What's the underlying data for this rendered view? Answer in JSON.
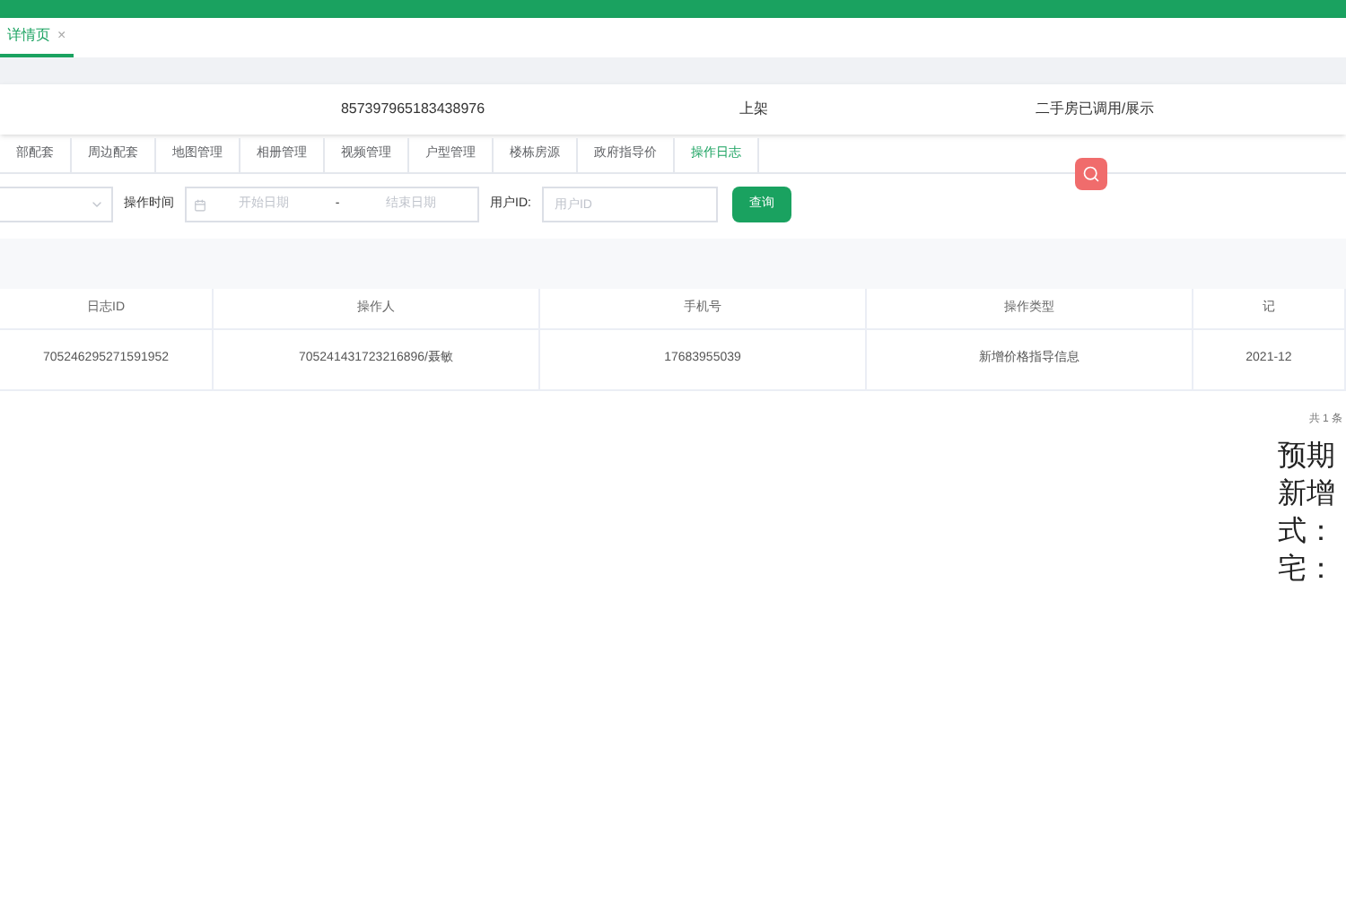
{
  "page_tabs": [
    {
      "label": "详情页",
      "close": "×",
      "selected": true
    }
  ],
  "summary": [
    "857397965183438976",
    "上架",
    "二手房已调用/展示"
  ],
  "tabs": [
    {
      "label": "部配套",
      "selected": false
    },
    {
      "label": "周边配套",
      "selected": false
    },
    {
      "label": "地图管理",
      "selected": false
    },
    {
      "label": "相册管理",
      "selected": false
    },
    {
      "label": "视频管理",
      "selected": false
    },
    {
      "label": "户型管理",
      "selected": false
    },
    {
      "label": "楼栋房源",
      "selected": false
    },
    {
      "label": "政府指导价",
      "selected": false
    },
    {
      "label": "操作日志",
      "selected": true
    }
  ],
  "filters": {
    "time_label": "操作时间",
    "start_placeholder": "开始日期",
    "separator": "-",
    "end_placeholder": "结束日期",
    "user_label": "用户ID:",
    "user_placeholder": "用户ID",
    "query_button": "查询"
  },
  "table": {
    "columns": [
      "日志ID",
      "操作人",
      "手机号",
      "操作类型",
      "记"
    ],
    "rows": [
      [
        "705246295271591952",
        "705241431723216896/聂敏",
        "17683955039",
        "新增价格指导信息",
        "2021-12"
      ]
    ]
  },
  "pagination": "共 1 条",
  "side_note": [
    "预期",
    "新增",
    "式：",
    "宅："
  ]
}
